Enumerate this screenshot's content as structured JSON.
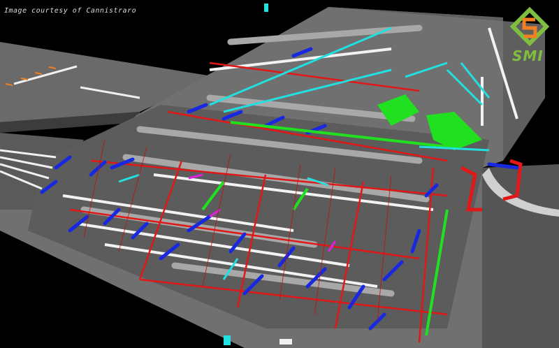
{
  "caption": "Image courtesy of Cannistraro",
  "logo": {
    "text": "SMI",
    "icon": "s-diamond-logo-icon",
    "color": "#7fbf3f"
  },
  "colors": {
    "background": "#000000",
    "slab": "#6e6e6e",
    "slab_dark": "#4a4a4a",
    "pipe_gray": "#a8a8a8",
    "pipe_white": "#f2f2f2",
    "pipe_red": "#e01818",
    "pipe_blue": "#1828e0",
    "pipe_green": "#20e020",
    "pipe_cyan": "#20e0e0",
    "pipe_magenta": "#e020e0",
    "pipe_orange": "#f08020"
  }
}
